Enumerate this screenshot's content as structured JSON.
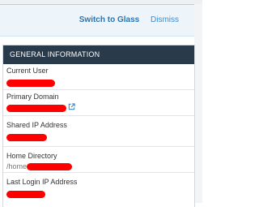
{
  "banner": {
    "switch_label": "Switch to Glass",
    "dismiss_label": "Dismiss"
  },
  "panel": {
    "title": "GENERAL INFORMATION",
    "rows": [
      {
        "label": "Current User",
        "value": "",
        "redacted": true
      },
      {
        "label": "Primary Domain",
        "value": "",
        "redacted": true,
        "icon": "external-link-icon"
      },
      {
        "label": "Shared IP Address",
        "value": "",
        "redacted": true
      },
      {
        "label": "Home Directory",
        "value": "/home",
        "redacted": true
      },
      {
        "label": "Last Login IP Address",
        "value": "",
        "redacted": true
      }
    ]
  },
  "colors": {
    "header_bg": "#293a4a",
    "link": "#2d73ad",
    "redaction": "#ff0000"
  }
}
